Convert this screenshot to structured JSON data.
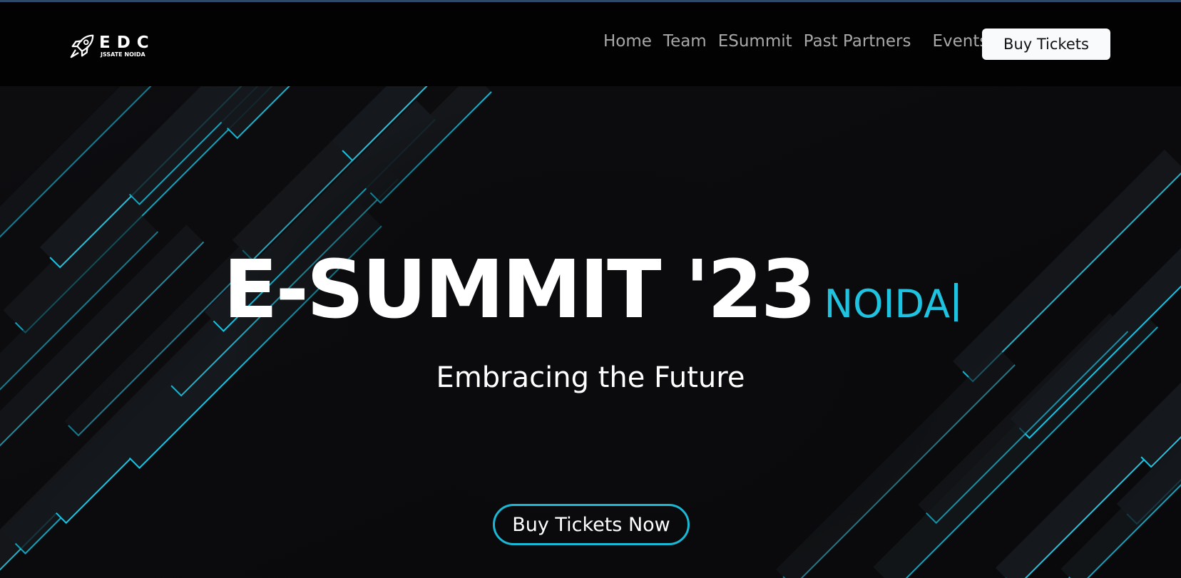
{
  "brand": {
    "logo_main": "EDC",
    "logo_sub": "JSSATE NOIDA",
    "logo_icon": "rocket-icon"
  },
  "nav": {
    "links": [
      {
        "label": "Home"
      },
      {
        "label": "Team"
      },
      {
        "label": "ESummit"
      },
      {
        "label": "Past Partners"
      },
      {
        "label": "Events"
      }
    ],
    "buy_button": "Buy Tickets"
  },
  "hero": {
    "title": "E-SUMMIT '23",
    "subtitle": "NOIDA",
    "tagline": "Embracing the Future",
    "cta": "Buy Tickets Now"
  },
  "colors": {
    "accent": "#1fc3e0",
    "background": "#0b0b0d",
    "navbar": "#020202"
  }
}
